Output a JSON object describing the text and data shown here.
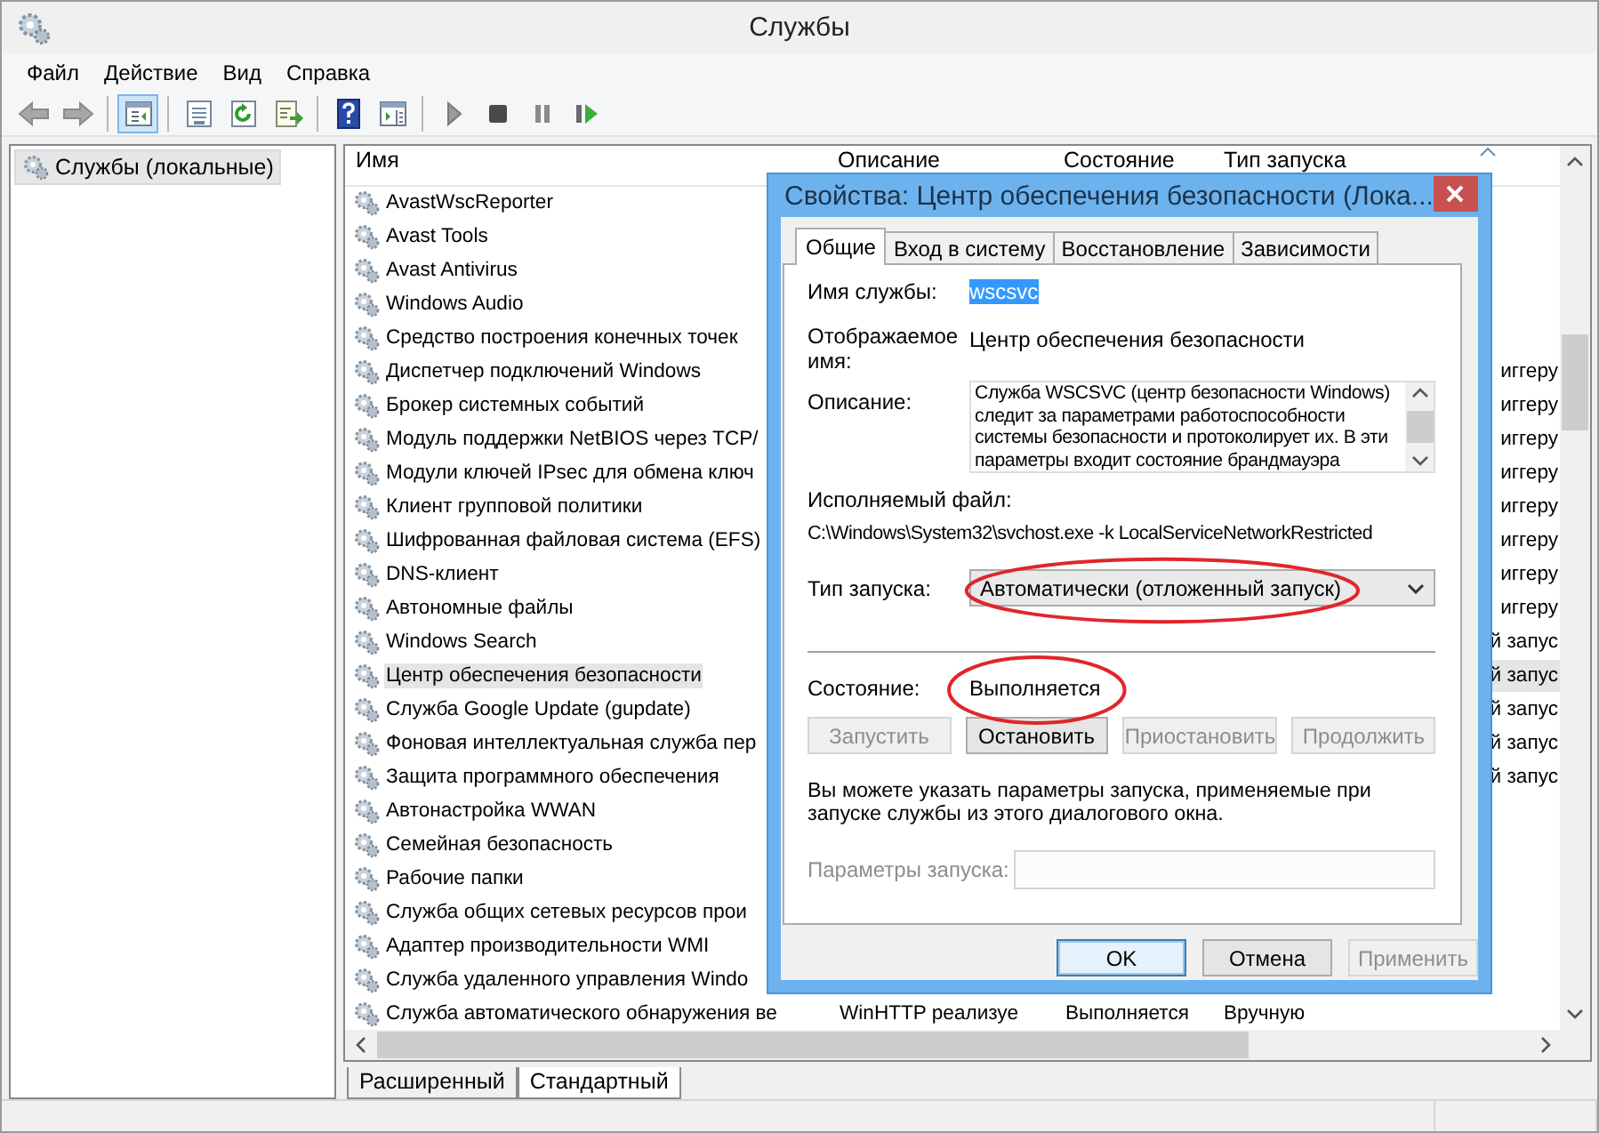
{
  "window": {
    "title": "Службы"
  },
  "menu": [
    {
      "label": "Файл"
    },
    {
      "label": "Действие"
    },
    {
      "label": "Вид"
    },
    {
      "label": "Справка"
    }
  ],
  "toolbar": [
    {
      "kind": "back",
      "pressed": false
    },
    {
      "kind": "forward",
      "pressed": false
    },
    {
      "kind": "sep"
    },
    {
      "kind": "tree",
      "pressed": true
    },
    {
      "kind": "sep"
    },
    {
      "kind": "props",
      "pressed": false
    },
    {
      "kind": "refresh",
      "pressed": false
    },
    {
      "kind": "export",
      "pressed": false
    },
    {
      "kind": "sep"
    },
    {
      "kind": "help",
      "pressed": false
    },
    {
      "kind": "pane",
      "pressed": false
    },
    {
      "kind": "sep"
    },
    {
      "kind": "play",
      "pressed": false
    },
    {
      "kind": "stop",
      "pressed": false
    },
    {
      "kind": "pause",
      "pressed": false
    },
    {
      "kind": "resume",
      "pressed": false
    }
  ],
  "tree": {
    "items": [
      {
        "label": "Службы (локальные)",
        "selected": true
      }
    ]
  },
  "table": {
    "columns": [
      "Имя",
      "Описание",
      "Состояние",
      "Тип запуска"
    ],
    "rows": [
      {
        "name": "AvastWscReporter",
        "selected": false
      },
      {
        "name": "Avast Tools",
        "selected": false
      },
      {
        "name": "Avast Antivirus",
        "selected": false
      },
      {
        "name": "Windows Audio",
        "selected": false
      },
      {
        "name": "Средство построения конечных точек",
        "selected": false
      },
      {
        "name": "Диспетчер подключений Windows",
        "selected": false,
        "startup_tail": "иггеру"
      },
      {
        "name": "Брокер системных событий",
        "selected": false,
        "startup_tail": "иггеру"
      },
      {
        "name": "Модуль поддержки NetBIOS через TCP/",
        "selected": false,
        "startup_tail": "иггеру"
      },
      {
        "name": "Модули ключей IPsec для обмена ключ",
        "selected": false,
        "startup_tail": "иггеру"
      },
      {
        "name": "Клиент групповой политики",
        "selected": false,
        "startup_tail": "иггеру"
      },
      {
        "name": "Шифрованная файловая система (EFS)",
        "selected": false,
        "startup_tail": "иггеру"
      },
      {
        "name": "DNS-клиент",
        "selected": false,
        "startup_tail": "иггеру"
      },
      {
        "name": "Автономные файлы",
        "selected": false,
        "startup_tail": "иггеру"
      },
      {
        "name": "Windows Search",
        "selected": false,
        "startup_tail": "й запус"
      },
      {
        "name": "Центр обеспечения безопасности",
        "selected": true,
        "startup_tail": "й запус"
      },
      {
        "name": "Служба Google Update (gupdate)",
        "selected": false,
        "startup_tail": "й запус"
      },
      {
        "name": "Фоновая интеллектуальная служба пер",
        "selected": false,
        "startup_tail": "й запус"
      },
      {
        "name": "Защита программного обеспечения",
        "selected": false,
        "startup_tail": "й запус"
      },
      {
        "name": "Автонастройка WWAN",
        "selected": false
      },
      {
        "name": "Семейная безопасность",
        "selected": false
      },
      {
        "name": "Рабочие папки",
        "selected": false
      },
      {
        "name": "Служба общих сетевых ресурсов прои",
        "selected": false
      },
      {
        "name": "Адаптер производительности WMI",
        "selected": false
      },
      {
        "name": "Служба удаленного управления Windo",
        "selected": false
      },
      {
        "name": "Служба автоматического обнаружения ве",
        "selected": false,
        "description": "WinHTTP реализуе",
        "state": "Выполняется",
        "startup": "Вручную"
      }
    ]
  },
  "view_tabs": [
    {
      "label": "Расширенный",
      "selected": false
    },
    {
      "label": "Стандартный",
      "selected": true
    }
  ],
  "dialog": {
    "title": "Свойства: Центр обеспечения безопасности (Лока...",
    "tabs": [
      {
        "label": "Общие",
        "selected": true
      },
      {
        "label": "Вход в систему",
        "selected": false
      },
      {
        "label": "Восстановление",
        "selected": false
      },
      {
        "label": "Зависимости",
        "selected": false
      }
    ],
    "service_name": {
      "label": "Имя службы:",
      "value": "wscsvc"
    },
    "display_name": {
      "label": "Отображаемое имя:",
      "value": "Центр обеспечения безопасности"
    },
    "description": {
      "label": "Описание:",
      "value": "Служба WSCSVC (центр безопасности Windows) следит за параметрами работоспособности системы безопасности и протоколирует их. В эти параметры входит состояние брандмауэра"
    },
    "executable": {
      "label": "Исполняемый файл:",
      "value": "C:\\Windows\\System32\\svchost.exe -k LocalServiceNetworkRestricted"
    },
    "startup_type": {
      "label": "Тип запуска:",
      "value": "Автоматически (отложенный запуск)",
      "circled": true
    },
    "status": {
      "label": "Состояние:",
      "value": "Выполняется",
      "circled": true
    },
    "service_buttons": [
      {
        "label": "Запустить",
        "disabled": true
      },
      {
        "label": "Остановить",
        "disabled": false
      },
      {
        "label": "Приостановить",
        "disabled": true
      },
      {
        "label": "Продолжить",
        "disabled": true
      }
    ],
    "hint": "Вы можете указать параметры запуска, применяемые при запуске службы из этого диалогового окна.",
    "start_params": {
      "label": "Параметры запуска:",
      "disabled": true
    },
    "buttons": [
      {
        "label": "OK",
        "default": true,
        "disabled": false
      },
      {
        "label": "Отмена",
        "default": false,
        "disabled": false
      },
      {
        "label": "Применить",
        "default": false,
        "disabled": true
      }
    ]
  }
}
